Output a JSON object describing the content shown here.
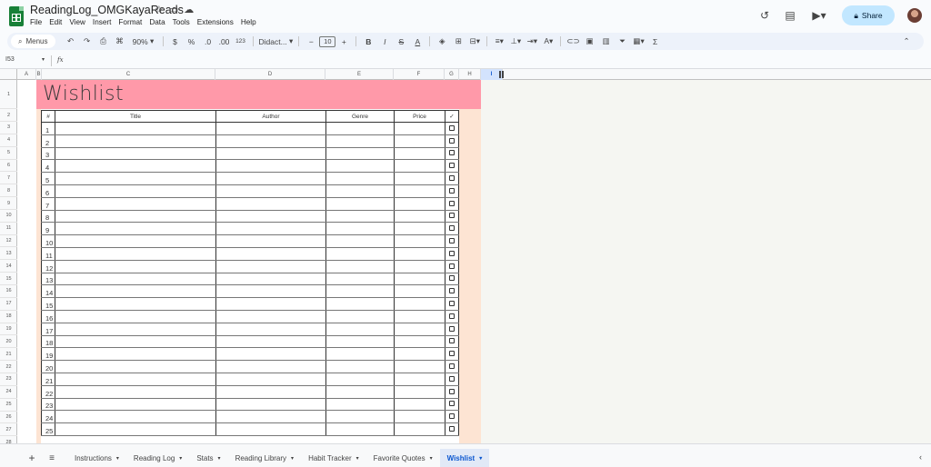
{
  "app": {
    "doc_title": "ReadingLog_OMGKayaReads",
    "menu": [
      "File",
      "Edit",
      "View",
      "Insert",
      "Format",
      "Data",
      "Tools",
      "Extensions",
      "Help"
    ],
    "share_label": "Share"
  },
  "toolbar": {
    "menus_label": "Menus",
    "zoom": "90%",
    "currency": "$",
    "percent": "%",
    "dec_decrease": ".0",
    "dec_increase": ".00",
    "number_format": "123",
    "font": "Didact...",
    "font_size": "10",
    "bold": "B",
    "italic": "I",
    "strike": "S",
    "text_color": "A",
    "sum": "Σ"
  },
  "formula_bar": {
    "name_box": "I53",
    "fx": "fx",
    "formula": ""
  },
  "columns": [
    "A",
    "B",
    "C",
    "D",
    "E",
    "F",
    "G",
    "H",
    "I"
  ],
  "rows": [
    "1",
    "2",
    "3",
    "4",
    "5",
    "6",
    "7",
    "8",
    "9",
    "10",
    "11",
    "12",
    "13",
    "14",
    "15",
    "16",
    "17",
    "18",
    "19",
    "20",
    "21",
    "22",
    "23",
    "24",
    "25",
    "26",
    "27",
    "28"
  ],
  "sheet": {
    "title": "Wishlist",
    "headers": {
      "num": "#",
      "title": "Title",
      "author": "Author",
      "genre": "Genre",
      "price": "Price",
      "check": "✓"
    },
    "row_numbers": [
      "1",
      "2",
      "3",
      "4",
      "5",
      "6",
      "7",
      "8",
      "9",
      "10",
      "11",
      "12",
      "13",
      "14",
      "15",
      "16",
      "17",
      "18",
      "19",
      "20",
      "21",
      "22",
      "23",
      "24",
      "25"
    ]
  },
  "tabs": [
    {
      "label": "Instructions",
      "active": false
    },
    {
      "label": "Reading Log",
      "active": false
    },
    {
      "label": "Stats",
      "active": false
    },
    {
      "label": "Reading Library",
      "active": false
    },
    {
      "label": "Habit Tracker",
      "active": false
    },
    {
      "label": "Favorite Quotes",
      "active": false
    },
    {
      "label": "Wishlist",
      "active": true
    }
  ],
  "colors": {
    "title_band": "#ff99a9",
    "side_band": "#fde4d3",
    "share_bg": "#c2e7ff",
    "accent": "#0b57d0"
  }
}
